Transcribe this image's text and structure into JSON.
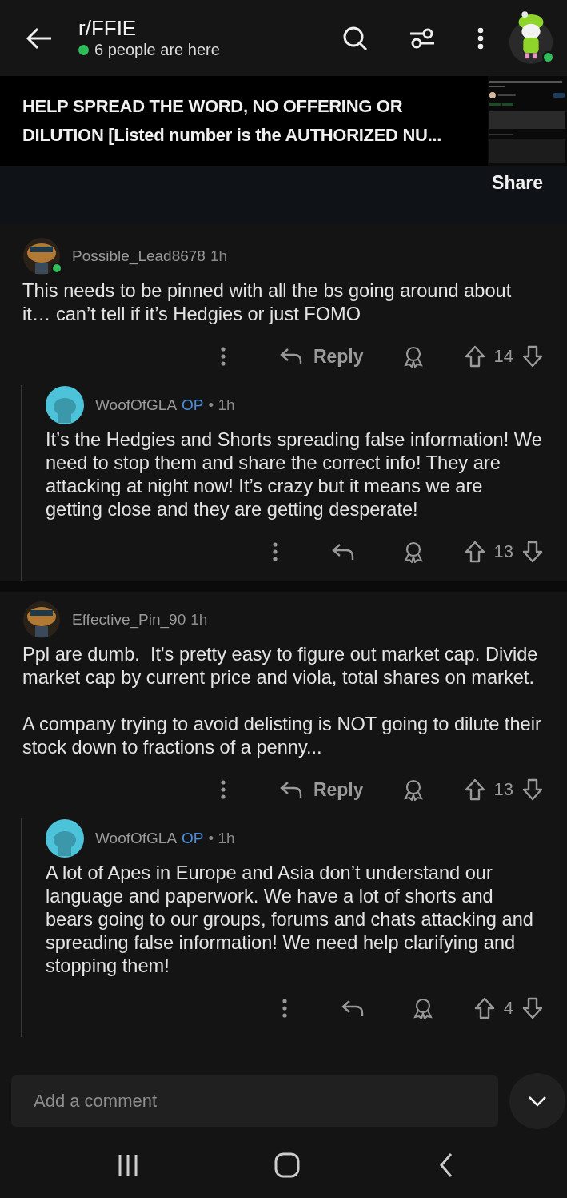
{
  "header": {
    "title": "r/FFIE",
    "presence": "6 people are here",
    "online": true,
    "user_online": true
  },
  "post": {
    "title": "HELP SPREAD THE WORD, NO OFFERING OR DILUTION [Listed number is the AUTHORIZED NU...",
    "share_label": "Share"
  },
  "comments": [
    {
      "author": "Possible_Lead8678",
      "time": "1h",
      "avatar": {
        "kind": "custom"
      },
      "online": true,
      "paragraphs": [
        "This needs to be pinned with all the bs going around about it… can’t tell if it’s Hedgies or just FOMO"
      ],
      "reply_label": "Reply",
      "votes": "14",
      "children": [
        {
          "author": "WoofOfGLA",
          "badge": "OP",
          "time": "• 1h",
          "avatar": {
            "kind": "default"
          },
          "online": false,
          "paragraphs": [
            "It’s the Hedgies and Shorts spreading false information! We need to stop them and share the correct info! They are attacking at night now! It’s crazy but it means we are getting close and they are getting desperate!"
          ],
          "votes": "13"
        }
      ]
    },
    {
      "author": "Effective_Pin_90",
      "time": "1h",
      "avatar": {
        "kind": "custom"
      },
      "online": false,
      "paragraphs": [
        "Ppl are dumb.  It's pretty easy to figure out market cap. Divide market cap by current price and viola, total shares on market.",
        "A company trying to avoid delisting is NOT going to dilute their stock down to fractions of a penny..."
      ],
      "reply_label": "Reply",
      "votes": "13",
      "children": [
        {
          "author": "WoofOfGLA",
          "badge": "OP",
          "time": "• 1h",
          "avatar": {
            "kind": "default"
          },
          "online": false,
          "paragraphs": [
            "A lot of Apes in Europe and Asia don’t understand our language and paperwork. We have a lot of shorts and bears going to our groups, forums and chats attacking and spreading false information! We need help clarifying and stopping them!"
          ],
          "votes": "4"
        }
      ]
    }
  ],
  "composer": {
    "placeholder": "Add a comment"
  }
}
